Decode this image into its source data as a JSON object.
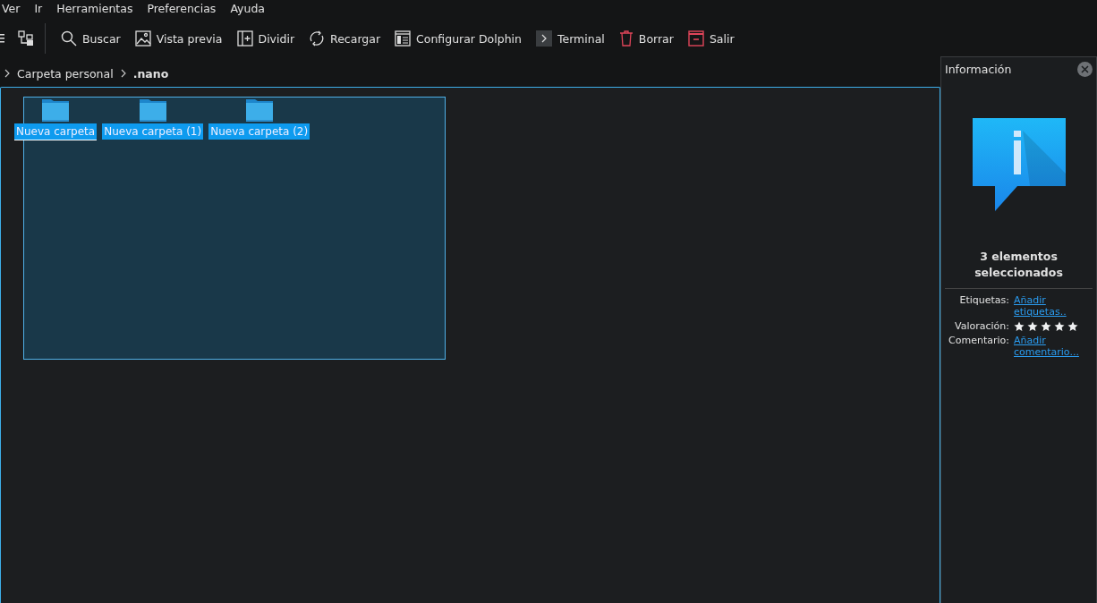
{
  "menu": [
    "Ver",
    "Ir",
    "Herramientas",
    "Preferencias",
    "Ayuda"
  ],
  "toolbar": [
    {
      "kind": "search",
      "label": "Buscar"
    },
    {
      "kind": "preview",
      "label": "Vista previa"
    },
    {
      "kind": "split",
      "label": "Dividir"
    },
    {
      "kind": "reload",
      "label": "Recargar"
    },
    {
      "kind": "configure",
      "label": "Configurar Dolphin"
    },
    {
      "kind": "terminal",
      "label": "Terminal"
    },
    {
      "kind": "delete",
      "label": "Borrar"
    },
    {
      "kind": "quit",
      "label": "Salir"
    }
  ],
  "breadcrumb": [
    {
      "label": "Carpeta personal",
      "current": false
    },
    {
      "label": ".nano",
      "current": true
    }
  ],
  "files": [
    {
      "name": "Nueva carpeta",
      "selected": true
    },
    {
      "name": "Nueva carpeta (1)",
      "selected": true
    },
    {
      "name": "Nueva carpeta (2)",
      "selected": true
    }
  ],
  "info_panel": {
    "title": "Información",
    "summary": "3 elementos seleccionados",
    "fields": [
      {
        "kind": "link",
        "label": "Etiquetas:",
        "value": "Añadir etiquetas.."
      },
      {
        "kind": "rating",
        "label": "Valoración:",
        "stars": 5
      },
      {
        "kind": "link",
        "label": "Comentario:",
        "value": "Añadir comentario..."
      }
    ]
  }
}
